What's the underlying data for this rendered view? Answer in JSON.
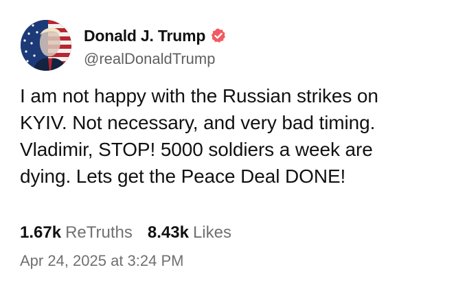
{
  "author": {
    "display_name": "Donald J. Trump",
    "handle": "@realDonaldTrump",
    "verified": true,
    "verified_color": "#f25a61"
  },
  "post": {
    "lines": [
      "I am not happy with the Russian strikes on",
      "KYIV. Not necessary, and very bad timing.",
      "Vladimir, STOP! 5000 soldiers a week are",
      "dying. Lets get the Peace Deal DONE!"
    ]
  },
  "stats": {
    "retruths_count": "1.67k",
    "retruths_label": "ReTruths",
    "likes_count": "8.43k",
    "likes_label": "Likes"
  },
  "timestamp": "Apr 24, 2025 at 3:24 PM",
  "icons": {
    "avatar": "avatar-flag-portrait",
    "verified": "verified-badge-icon"
  }
}
